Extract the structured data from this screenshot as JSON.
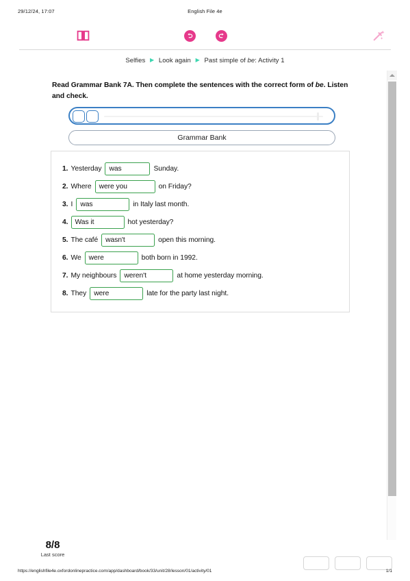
{
  "print_header": {
    "date": "29/12/24, 17:07",
    "title": "English File 4e"
  },
  "toolbar": {
    "book_icon": "open-book-icon",
    "undo_icon": "undo-icon",
    "redo_icon": "redo-icon",
    "wand_icon": "magic-wand-icon",
    "accent_color": "#e6398b",
    "accent_disabled_color": "#f5a8cd"
  },
  "breadcrumb": {
    "separator": "▶",
    "separator_color": "#3dd6b0",
    "item1": "Selfies",
    "item2": "Look again",
    "item3_pre": "Past simple of ",
    "item3_em": "be",
    "item3_post": ": Activity 1"
  },
  "instruction": {
    "part1": "Read Grammar Bank 7A. Then complete the sentences with the correct form of ",
    "em": "be",
    "part2": ". Listen and check."
  },
  "audio_player": {
    "name": "audio-player",
    "play_button": "play-button",
    "stop_button": "stop-button",
    "border_color": "#3a7fc4"
  },
  "grammar_bank": {
    "label": "Grammar Bank"
  },
  "questions": [
    {
      "num": "1.",
      "pre": "Yesterday",
      "value": "was",
      "post": "Sunday.",
      "width": "w-sm"
    },
    {
      "num": "2.",
      "pre": "Where",
      "value": "were you",
      "post": "on Friday?",
      "width": "w-lg"
    },
    {
      "num": "3.",
      "pre": "I",
      "value": "was",
      "post": "in Italy last month.",
      "width": "w-md"
    },
    {
      "num": "4.",
      "pre": "",
      "value": "Was it",
      "post": "hot yesterday?",
      "width": "w-md"
    },
    {
      "num": "5.",
      "pre": "The café",
      "value": "wasn't",
      "post": "open this morning.",
      "width": "w-md"
    },
    {
      "num": "6.",
      "pre": "We",
      "value": "were",
      "post": "both born in 1992.",
      "width": "w-md"
    },
    {
      "num": "7.",
      "pre": "My neighbours",
      "value": "weren't",
      "post": "at home yesterday morning.",
      "width": "w-md"
    },
    {
      "num": "8.",
      "pre": "They",
      "value": "were",
      "post": "late for the party last night.",
      "width": "w-md"
    }
  ],
  "score": {
    "value": "8/8",
    "label": "Last score"
  },
  "footer": {
    "url": "https://englishfile4e.oxfordonlinepractice.com/app/dashboard/book/33/unit/28/lesson/01/activity/01",
    "page": "1/1"
  },
  "scrollbar": {
    "name": "vertical-scrollbar"
  }
}
